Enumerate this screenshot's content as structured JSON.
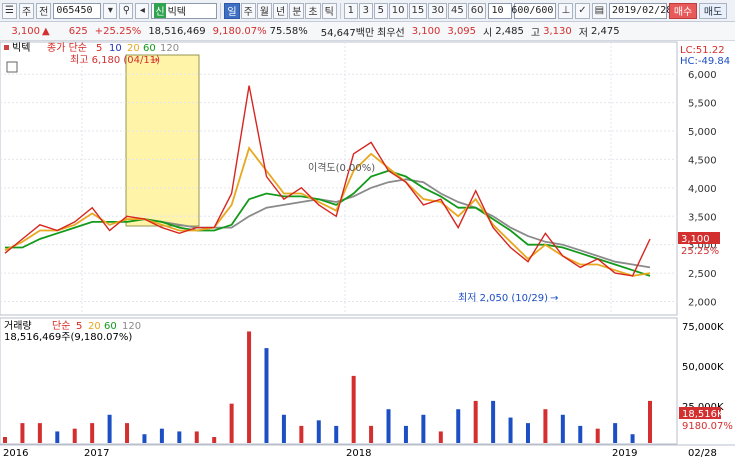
{
  "toolbar": {
    "market_label": "주",
    "type_label": "전",
    "code": "065450",
    "stock_name": "빅텍",
    "period_tabs": [
      "일",
      "주",
      "월",
      "년",
      "분",
      "초",
      "틱"
    ],
    "active_period": "일",
    "minute_buttons": [
      "1",
      "3",
      "5",
      "10",
      "15",
      "30",
      "45",
      "60"
    ],
    "interval_value": "10",
    "count_value": "600/600",
    "date_value": "2019/02/28",
    "buy_label": "매수",
    "sell_label": "매도"
  },
  "info": {
    "price": "3,100",
    "change": "625",
    "change_rate": "+25.25%",
    "volume": "18,516,469",
    "volume_rate": "9,180.07%",
    "turnover_rate": "75.58%",
    "trade_value": "54,647백만",
    "preferred_label": "최우선",
    "preferred_price": "3,100",
    "ask_price": "3,095",
    "open_label": "시",
    "open": "2,485",
    "high_label": "고",
    "high": "3,130",
    "low_label": "저",
    "low": "2,475"
  },
  "price_panel": {
    "title": "빅텍",
    "ma_label": "종가 단순",
    "ma_periods": [
      "5",
      "10",
      "20",
      "60",
      "120"
    ],
    "ma_colors": [
      "#d7261f",
      "#2332c4",
      "#e8a820",
      "#129a1a",
      "#8a8a8a"
    ],
    "lc_label": "LC:51.22",
    "hc_label": "HC:-49.84",
    "high_annotation": "최고 6,180 (04/11)",
    "low_annotation": "최저 2,050 (10/29)",
    "divergence_label": "이격도(0.00%)",
    "last_price_tag": "3,100",
    "last_rate_tag": "25.25%",
    "y_ticks": [
      "6,000",
      "5,500",
      "5,000",
      "4,500",
      "4,000",
      "3,500",
      "3,000",
      "2,500",
      "2,000"
    ],
    "y_tick_values": [
      6000,
      5500,
      5000,
      4500,
      4000,
      3500,
      3000,
      2500,
      2000
    ]
  },
  "volume_panel": {
    "title": "거래량",
    "ma_label": "단순",
    "ma_periods": [
      "5",
      "20",
      "60",
      "120"
    ],
    "summary": "18,516,469주(9,180.07%)",
    "y_ticks": [
      "75,000K",
      "50,000K",
      "25,000K"
    ],
    "last_volume_tag": "18,516K",
    "last_rate_tag": "9180.07%"
  },
  "x_axis": {
    "labels": [
      "2016",
      "2017",
      "2018",
      "2019",
      "02/28"
    ]
  },
  "chart_data": {
    "type": "line",
    "title": "빅텍",
    "ylim": [
      1850,
      6250
    ],
    "x": [
      "2016-01",
      "2016-02",
      "2016-03",
      "2016-04",
      "2016-05",
      "2016-06",
      "2016-07",
      "2016-08",
      "2016-09",
      "2016-10",
      "2016-11",
      "2016-12",
      "2017-01",
      "2017-02",
      "2017-03",
      "2017-04",
      "2017-05",
      "2017-06",
      "2017-07",
      "2017-08",
      "2017-09",
      "2017-10",
      "2017-11",
      "2017-12",
      "2018-01",
      "2018-02",
      "2018-03",
      "2018-04",
      "2018-05",
      "2018-06",
      "2018-07",
      "2018-08",
      "2018-09",
      "2018-10",
      "2018-11",
      "2018-12",
      "2019-01",
      "2019-02"
    ],
    "series": [
      {
        "name": "5",
        "values": [
          2850,
          3100,
          3350,
          3250,
          3400,
          3650,
          3250,
          3500,
          3450,
          3300,
          3200,
          3300,
          3300,
          3900,
          5800,
          4200,
          3800,
          4000,
          3700,
          3500,
          4600,
          4800,
          4300,
          4100,
          3700,
          3800,
          3300,
          3950,
          3300,
          2950,
          2700,
          3200,
          2800,
          2600,
          2750,
          2500,
          2450,
          3100
        ]
      },
      {
        "name": "20",
        "values": [
          2900,
          3050,
          3250,
          3250,
          3350,
          3550,
          3350,
          3450,
          3450,
          3350,
          3250,
          3250,
          3300,
          3700,
          4700,
          4300,
          3900,
          3900,
          3750,
          3600,
          4300,
          4600,
          4350,
          4100,
          3800,
          3750,
          3500,
          3800,
          3350,
          3050,
          2750,
          3000,
          2800,
          2650,
          2650,
          2550,
          2450,
          2500
        ]
      },
      {
        "name": "60",
        "values": [
          2950,
          2950,
          3100,
          3200,
          3300,
          3400,
          3400,
          3400,
          3450,
          3400,
          3300,
          3250,
          3250,
          3350,
          3800,
          3900,
          3850,
          3850,
          3800,
          3700,
          3900,
          4200,
          4300,
          4200,
          4000,
          3850,
          3650,
          3650,
          3450,
          3250,
          3000,
          3000,
          2950,
          2850,
          2750,
          2650,
          2550,
          2450
        ]
      },
      {
        "name": "120",
        "values": [
          null,
          null,
          null,
          null,
          null,
          null,
          null,
          3400,
          3450,
          3400,
          3350,
          3300,
          3300,
          3300,
          3500,
          3650,
          3700,
          3750,
          3800,
          3750,
          3850,
          4000,
          4100,
          4150,
          4100,
          3900,
          3750,
          3650,
          3500,
          3300,
          3150,
          3050,
          3000,
          2900,
          2800,
          2700,
          2650,
          2600
        ]
      }
    ],
    "ylabel": ""
  },
  "colors": {
    "up": "#d32f2f",
    "down": "#1d4fc4",
    "highlight_box": "#fff4a8"
  }
}
